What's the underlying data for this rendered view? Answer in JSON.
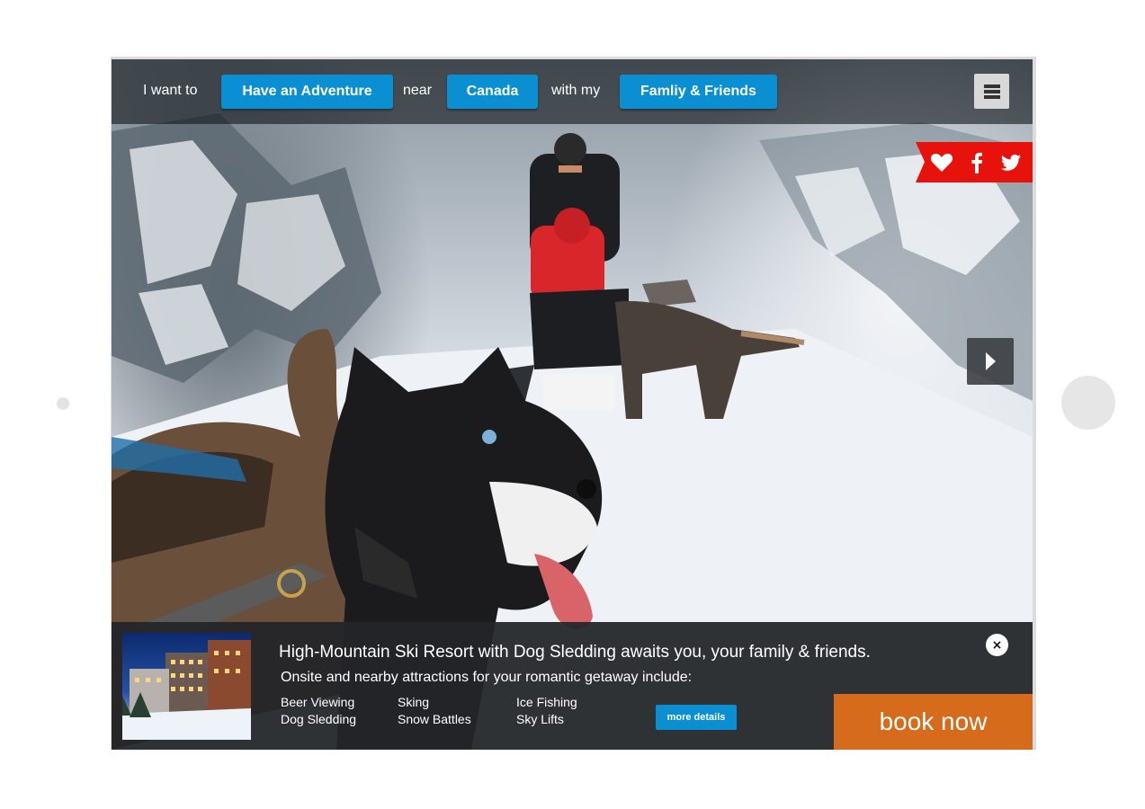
{
  "topbar": {
    "prefix_text": "I want to",
    "activity_label": "Have an Adventure",
    "near_text": "near",
    "location_label": "Canada",
    "with_text": "with my",
    "company_label": "Famliy & Friends",
    "menu_icon": "menu-icon"
  },
  "social": {
    "icons": [
      "heart-icon",
      "facebook-icon",
      "twitter-icon"
    ],
    "bg_color": "#e8120c"
  },
  "hero": {
    "next_icon": "chevron-right-icon"
  },
  "offer": {
    "title": "High-Mountain Ski Resort with Dog Sledding awaits you, your family & friends.",
    "subtitle": "Onsite and nearby attractions for your romantic getaway include:",
    "attractions": [
      "Beer Viewing",
      "Dog Sledding",
      "Sking",
      "Snow Battles",
      "Ice Fishing",
      "Sky Lifts"
    ],
    "more_label": "more details",
    "close_label": "×",
    "book_label": "book now"
  },
  "colors": {
    "accent_blue": "#0b8fd3",
    "book_orange": "#d76b1c",
    "panel_bg": "#232528"
  }
}
